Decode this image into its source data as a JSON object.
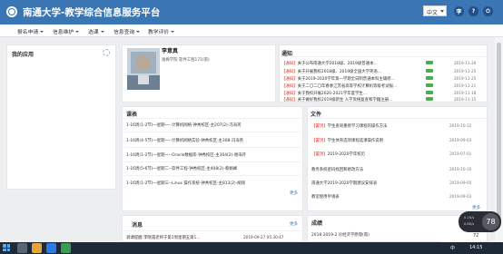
{
  "header": {
    "title": "南通大学-教学综合信息服务平台",
    "lang": "中文",
    "icon_user": "李",
    "icon_logout": "⏻",
    "colors": {
      "primary": "#3a75b4",
      "tag": "#e0352b",
      "badge": "#4cae4c"
    }
  },
  "nav": {
    "items": [
      "报名申请",
      "信息维护",
      "选课",
      "信息查询",
      "教学评价"
    ]
  },
  "my_apps": {
    "title": "我的应用"
  },
  "profile": {
    "name": "李意真",
    "info": "逸梅学院 软件工程171(南)"
  },
  "notice": {
    "title": "通知",
    "items": [
      {
        "tag": "【通知】",
        "text": "关于公布南通大学2018级、2019级普通本...",
        "date": "2019-11-29",
        "new": true
      },
      {
        "tag": "【通知】",
        "text": "关于开展我校2018级、2019级全国大学英语...",
        "date": "2019-11-25",
        "new": true
      },
      {
        "tag": "【通知】",
        "text": "关于2019-2020学年第一学期全日制普通本科主辅修...",
        "date": "2019-11-25",
        "new": true
      },
      {
        "tag": "【通知】",
        "text": "关于二〇二〇年春季江苏省高等学校计算机等级考试报...",
        "date": "2019-11-21",
        "new": true
      },
      {
        "tag": "【通知】",
        "text": "关于我校开展2020-2021学年度学生...",
        "date": "2019-11-18",
        "new": true
      },
      {
        "tag": "【通知】",
        "text": "关于做好我校2019级新生 入学资格复查和学籍注册...",
        "date": "2019-11-15",
        "new": true
      }
    ]
  },
  "courses": {
    "title": "课表",
    "more": "更多",
    "items": [
      "1-16周(1-2节)一星期一--计算机网络-钟秀校区-主207(2)-冯海英",
      "1-16周(4-5节)一星期一--计算机网络实验-钟秀校区-主308-冯海英",
      "1-16周(1-2节)一星期一--Oracle数据库-钟秀校区-主304(2)-谢海芹",
      "1-16周(5-6节)一星期二--软件工程-钟秀校区-主408(2)-蔡娟峰",
      "1-16周(1-2节)一星期三--Linux 操作系统-钟秀校区-主813(2)-胡翔"
    ]
  },
  "docs": {
    "title": "文件",
    "more": "更多",
    "items": [
      {
        "tag": "【置顶】",
        "text": "学生查询重修学习课程的操作方法",
        "date": "2019-10-12"
      },
      {
        "tag": "【置顶】",
        "text": "学生体育选项课程选课操作说明",
        "date": "2019-09-03"
      },
      {
        "tag": "【置顶】",
        "text": "2019-2020学年校历",
        "date": "2019-07-01"
      },
      {
        "tag": "",
        "text": "教务系统密码找回和修改方法",
        "date": "2019-10-10"
      },
      {
        "tag": "",
        "text": "南通大学2019-2020学期建议安排表",
        "date": "2019-09-05"
      },
      {
        "tag": "",
        "text": "教室使用申请表",
        "date": "2019-09-03"
      }
    ]
  },
  "messages": {
    "title": "消息",
    "more": "更多",
    "items": [
      {
        "text": "调课提醒:李晓霞老师于第1周星期五第1...",
        "date": "2019-09-27 05:30:47"
      }
    ]
  },
  "grades": {
    "title": "成绩",
    "items": [
      {
        "text": "2018-2019-2 论经济学原理(南)",
        "score": "72"
      }
    ]
  },
  "widget": {
    "value": "78",
    "up": "0.1K/s",
    "down": "0.8K/s"
  },
  "taskbar": {
    "time": "14:15",
    "ime": "中"
  }
}
